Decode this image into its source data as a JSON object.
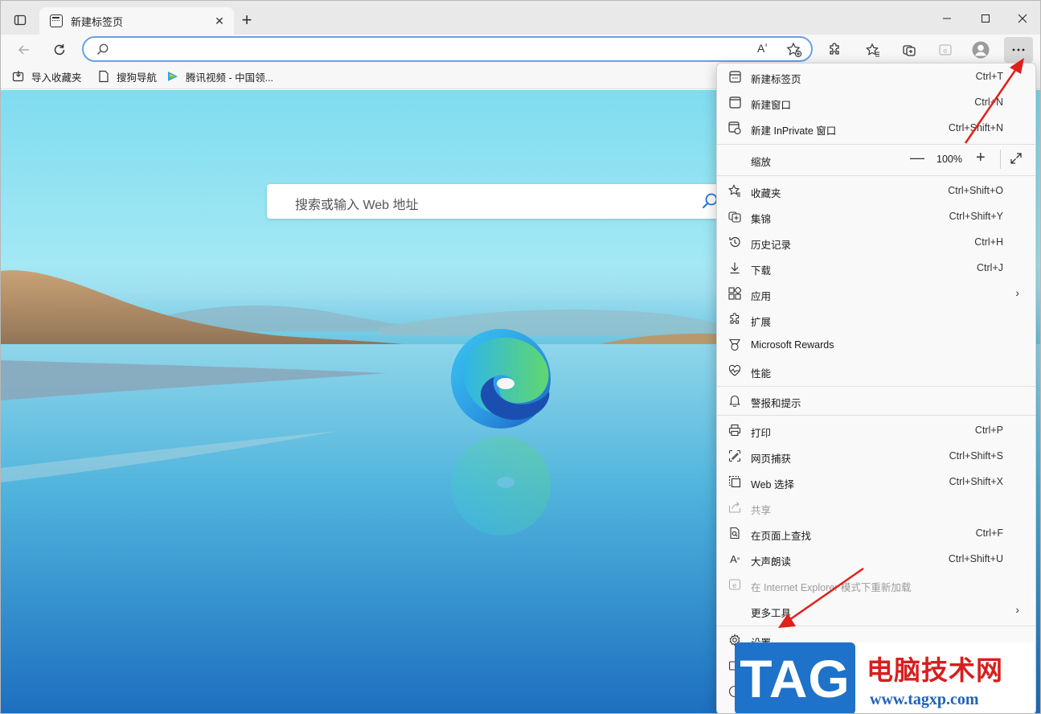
{
  "tab": {
    "title": "新建标签页"
  },
  "bookmarks": [
    {
      "label": "导入收藏夹"
    },
    {
      "label": "搜狗导航"
    },
    {
      "label": "腾讯视频 - 中国领..."
    }
  ],
  "toolbar": {
    "read_aloud": "Aᵃ"
  },
  "page": {
    "search_placeholder": "搜索或输入 Web 地址"
  },
  "menu": {
    "new_tab": {
      "label": "新建标签页",
      "shortcut": "Ctrl+T"
    },
    "new_window": {
      "label": "新建窗口",
      "shortcut": "Ctrl+N"
    },
    "new_inprivate": {
      "label": "新建 InPrivate 窗口",
      "shortcut": "Ctrl+Shift+N"
    },
    "zoom": {
      "label": "缩放",
      "value": "100%",
      "minus": "—",
      "plus": "+"
    },
    "favorites": {
      "label": "收藏夹",
      "shortcut": "Ctrl+Shift+O"
    },
    "collections": {
      "label": "集锦",
      "shortcut": "Ctrl+Shift+Y"
    },
    "history": {
      "label": "历史记录",
      "shortcut": "Ctrl+H"
    },
    "downloads": {
      "label": "下载",
      "shortcut": "Ctrl+J"
    },
    "apps": {
      "label": "应用"
    },
    "extensions": {
      "label": "扩展"
    },
    "rewards": {
      "label": "Microsoft Rewards"
    },
    "performance": {
      "label": "性能"
    },
    "alerts": {
      "label": "警报和提示"
    },
    "print": {
      "label": "打印",
      "shortcut": "Ctrl+P"
    },
    "web_capture": {
      "label": "网页捕获",
      "shortcut": "Ctrl+Shift+S"
    },
    "web_select": {
      "label": "Web 选择",
      "shortcut": "Ctrl+Shift+X"
    },
    "share": {
      "label": "共享"
    },
    "find": {
      "label": "在页面上查找",
      "shortcut": "Ctrl+F"
    },
    "read_aloud": {
      "label": "大声朗读",
      "shortcut": "Ctrl+Shift+U"
    },
    "ie_mode": {
      "label": "在 Internet Explorer 模式下重新加载"
    },
    "more_tools": {
      "label": "更多工具"
    },
    "settings": {
      "label": "设置"
    }
  },
  "watermark": {
    "tag": "TAG",
    "title": "电脑技术网",
    "url": "www.tagxp.com"
  },
  "colors": {
    "accent": "#1e72c9",
    "arrow": "#e0201b",
    "address_border": "#6a9fe8"
  }
}
